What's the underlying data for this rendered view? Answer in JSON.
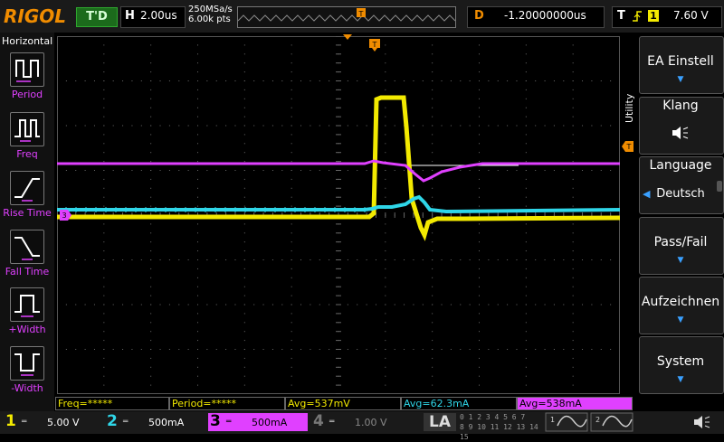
{
  "topbar": {
    "brand": "RIGOL",
    "trigger_state": "T'D",
    "horizontal_label": "H",
    "timebase": "2.00us",
    "sample_rate": "250MSa/s",
    "memory_points": "6.00k pts",
    "delay_label": "D",
    "delay_value": "-1.20000000us",
    "trigger_label": "T",
    "trigger_source": "1",
    "trigger_level": "7.60 V"
  },
  "left_menu": {
    "title": "Horizontal",
    "items": [
      {
        "label": "Period",
        "icon": "period-icon"
      },
      {
        "label": "Freq",
        "icon": "frequency-icon"
      },
      {
        "label": "Rise Time",
        "icon": "rise-time-icon"
      },
      {
        "label": "Fall Time",
        "icon": "fall-time-icon"
      },
      {
        "label": "+Width",
        "icon": "positive-width-icon"
      },
      {
        "label": "-Width",
        "icon": "negative-width-icon"
      }
    ]
  },
  "right_menu": {
    "tab_label": "Utility",
    "buttons": [
      {
        "label": "EA Einstell",
        "sub": ""
      },
      {
        "label": "Klang",
        "sub": ""
      },
      {
        "label": "Language",
        "sub": "Deutsch"
      },
      {
        "label": "Pass/Fail",
        "sub": ""
      },
      {
        "label": "Aufzeichnen",
        "sub": ""
      },
      {
        "label": "System",
        "sub": ""
      }
    ]
  },
  "measurements": [
    {
      "text": "Freq=*****",
      "color": "#f3ea00"
    },
    {
      "text": "Period=*****",
      "color": "#f3ea00"
    },
    {
      "text": "Avg=537mV",
      "color": "#f3ea00"
    },
    {
      "text": "Avg=62.3mA",
      "color": "#2fd6e8"
    },
    {
      "text": "Avg=538mA",
      "color": "#e040ff"
    }
  ],
  "channels": [
    {
      "num": "1",
      "scale": "5.00 V",
      "color": "#f3ea00"
    },
    {
      "num": "2",
      "scale": "500mA",
      "color": "#2fd6e8"
    },
    {
      "num": "3",
      "scale": "500mA",
      "color": "#e040ff"
    },
    {
      "num": "4",
      "scale": "1.00 V",
      "color": "#777777"
    }
  ],
  "la_label": "LA",
  "la_digits_top": "0 1 2 3  4 5 6 7",
  "la_digits_bottom": "8 9 10 11  12 13 14 15",
  "gen_labels": [
    "1",
    "2"
  ],
  "markers": {
    "ch3_marker": "3",
    "trig_marker": "T"
  },
  "colors": {
    "ch1": "#f3ea00",
    "ch2": "#2fd6e8",
    "ch3": "#e040ff",
    "accent": "#f08c00"
  }
}
